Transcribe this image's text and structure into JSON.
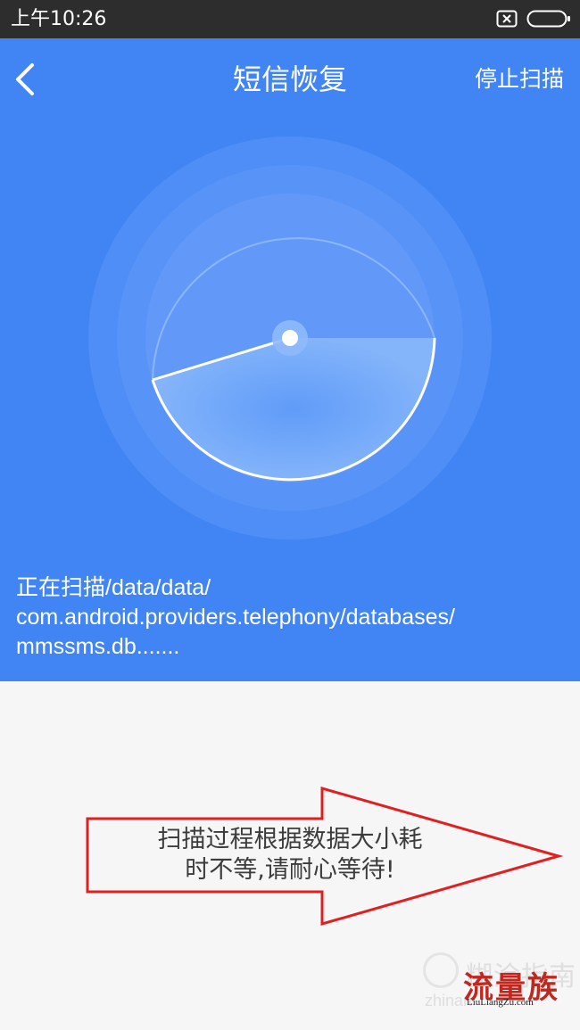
{
  "status_bar": {
    "time": "上午10:26",
    "icons": [
      "sim-off-icon",
      "battery-icon"
    ]
  },
  "header": {
    "back_icon": "chevron-left-icon",
    "title": "短信恢复",
    "stop_label": "停止扫描",
    "background_color": "#4185f5"
  },
  "radar": {
    "icon": "radar-scan-icon"
  },
  "scan_status": {
    "lines": [
      "正在扫描/data/data/",
      "com.android.providers.telephony/databases/",
      "mmssms.db......."
    ]
  },
  "annotation": {
    "arrow_color": "#e02020",
    "lines": [
      "扫描过程根据数据大小耗",
      "时不等,请耐心等待!"
    ]
  },
  "watermarks": {
    "baidu_text": "糊涂指南",
    "baidu_sub": "zhinan",
    "brand_text": "流量族",
    "brand_site": "LiuLiangZu.com"
  }
}
